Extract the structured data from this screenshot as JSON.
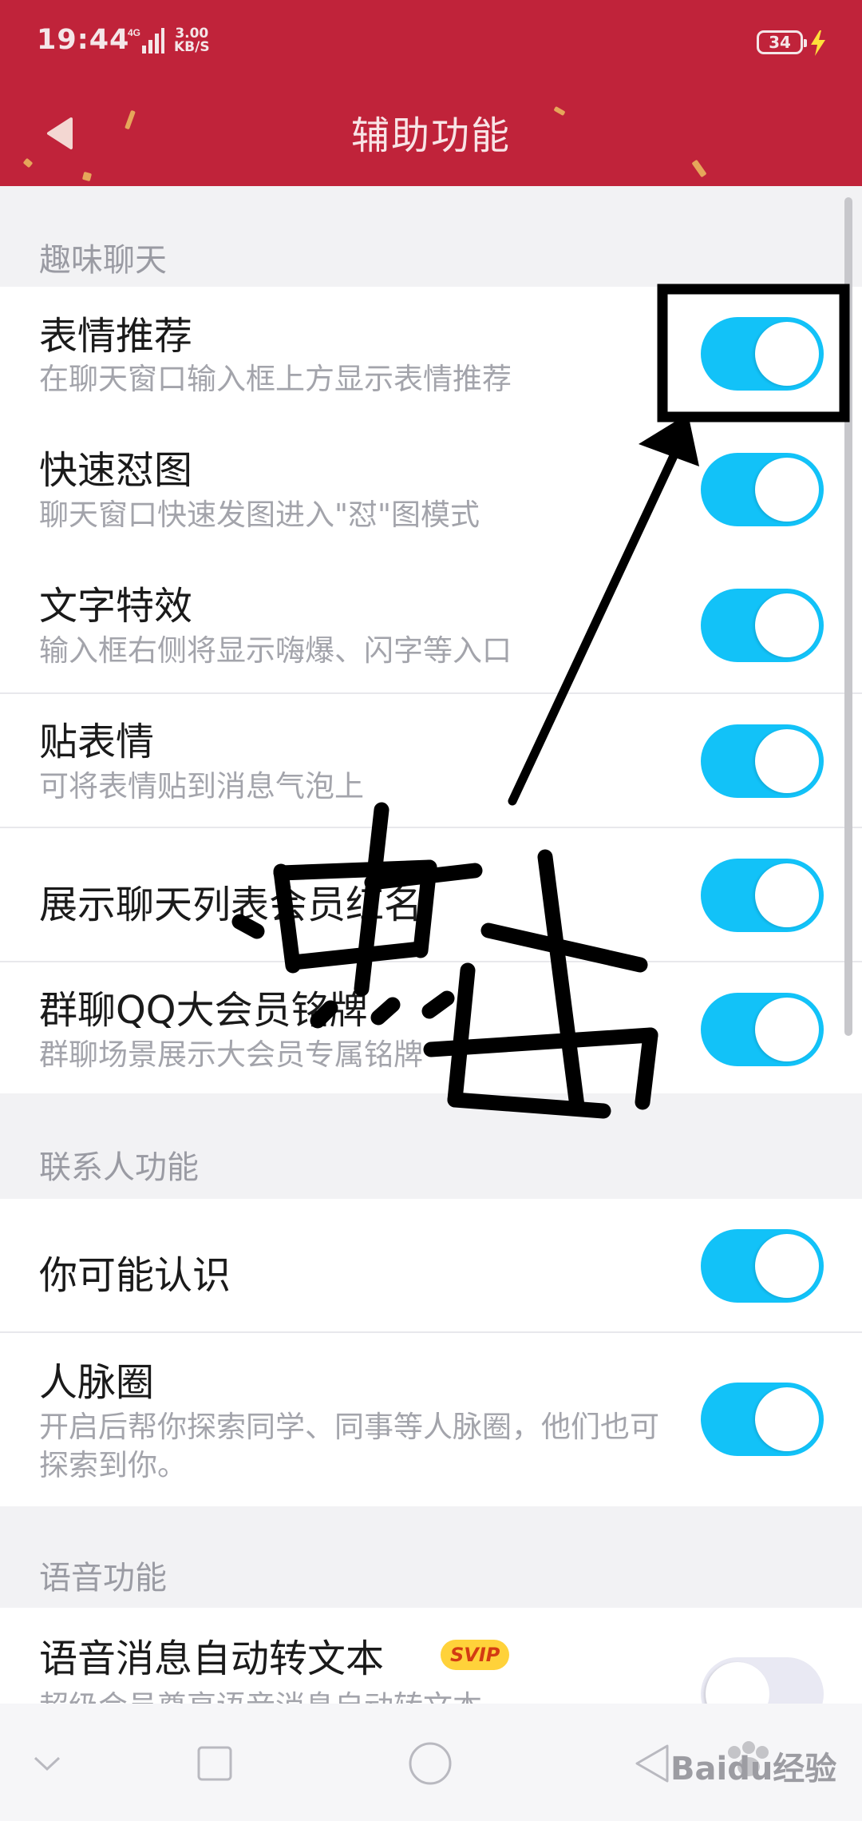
{
  "status_bar": {
    "time": "19:44",
    "net_speed_value": "3.00",
    "net_speed_unit": "KB/S",
    "battery": "34",
    "signal_label": "4G"
  },
  "header": {
    "title": "辅助功能",
    "back_icon": "back-arrow-icon",
    "color": "#c0233a"
  },
  "sections": [
    {
      "title": "趣味聊天",
      "items": [
        {
          "title": "表情推荐",
          "subtitle": "在聊天窗口输入框上方显示表情推荐",
          "enabled": true
        },
        {
          "title": "快速怼图",
          "subtitle": "聊天窗口快速发图进入\"怼\"图模式",
          "enabled": true
        },
        {
          "title": "文字特效",
          "subtitle": "输入框右侧将显示嗨爆、闪字等入口",
          "enabled": true
        },
        {
          "title": "贴表情",
          "subtitle": "可将表情贴到消息气泡上",
          "enabled": true
        },
        {
          "title": "展示聊天列表会员红名",
          "subtitle": "",
          "enabled": true
        },
        {
          "title": "群聊QQ大会员铭牌",
          "subtitle": "群聊场景展示大会员专属铭牌",
          "enabled": true
        }
      ]
    },
    {
      "title": "联系人功能",
      "items": [
        {
          "title": "你可能认识",
          "subtitle": "",
          "enabled": true
        },
        {
          "title": "人脉圈",
          "subtitle": "开启后帮你探索同学、同事等人脉圈，他们也可探索到你。",
          "enabled": true
        }
      ]
    },
    {
      "title": "语音功能",
      "items": [
        {
          "title": "语音消息自动转文本",
          "badge": "SVIP",
          "subtitle": "超级会员尊享语音消息自动转文本",
          "enabled": false
        }
      ]
    }
  ],
  "annotation": {
    "text": "点击",
    "color": "#000000"
  },
  "nav": {
    "back_icon": "chevron-down-icon",
    "recents_icon": "square-icon",
    "home_icon": "circle-icon",
    "back_triangle_icon": "triangle-back-icon"
  },
  "watermark": {
    "text": "Baidu经验",
    "url": "jingyan.baidu.com"
  },
  "colors": {
    "switch_on": "#12c2f8",
    "switch_off": "#e9e9f3",
    "section_text": "#9a9ba3"
  }
}
